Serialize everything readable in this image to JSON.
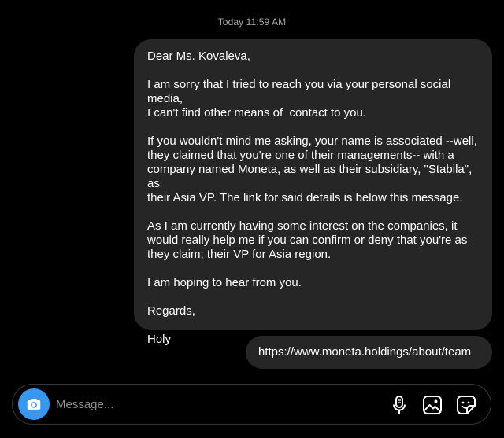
{
  "thread": {
    "timestamp": "Today 11:59 AM"
  },
  "messages": [
    {
      "paragraphs": [
        "Dear Ms. Kovaleva,",
        "I am sorry that I tried to reach you via your personal social media,\nI can't find other means of  contact to you.",
        "If you wouldn't mind me asking, your name is associated --well,\nthey claimed that you're one of their managements-- with a\ncompany named Moneta, as well as their subsidiary, \"Stabila\", as\ntheir Asia VP. The link for said details is below this message.",
        "As I am currently having some interest on the companies, it\nwould really help me if you can confirm or deny that you're as\nthey claim; their VP for Asia region.",
        "I am hoping to hear from you.",
        "Regards,",
        "Holy"
      ]
    },
    {
      "text": "https://www.moneta.holdings/about/team"
    }
  ],
  "composer": {
    "placeholder": "Message..."
  },
  "icons": {
    "camera": "camera-icon",
    "mic": "microphone-icon",
    "gallery": "gallery-icon",
    "sticker": "sticker-icon"
  },
  "colors": {
    "background": "#000000",
    "bubble": "#262626",
    "camera_button": "#3897f0",
    "timestamp": "#a8a8a8",
    "placeholder": "#8e8e8e"
  }
}
